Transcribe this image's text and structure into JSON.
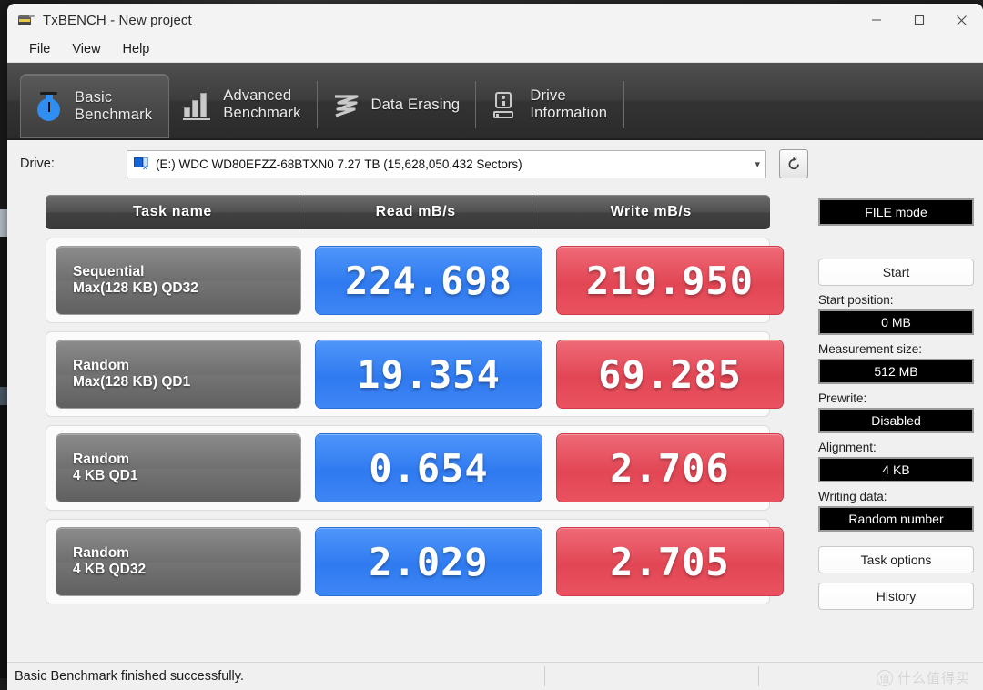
{
  "window": {
    "title": "TxBENCH - New project",
    "app_icon": "hard-disk-icon",
    "controls": {
      "minimize": "minimize-icon",
      "maximize": "maximize-icon",
      "close": "close-icon"
    }
  },
  "menu": {
    "items": [
      "File",
      "View",
      "Help"
    ]
  },
  "tabs": [
    {
      "label": "Basic\nBenchmark",
      "icon": "stopwatch-icon",
      "active": true
    },
    {
      "label": "Advanced\nBenchmark",
      "icon": "bar-chart-icon",
      "active": false
    },
    {
      "label": "Data Erasing",
      "icon": "erase-icon",
      "active": false
    },
    {
      "label": "Drive\nInformation",
      "icon": "drive-info-icon",
      "active": false
    }
  ],
  "drive": {
    "label": "Drive:",
    "value": "(E:) WDC WD80EFZZ-68BTXN0  7.27 TB (15,628,050,432 Sectors)",
    "icon": "disk-volume-icon",
    "caret": "chevron-down-icon",
    "refresh_icon": "refresh-icon"
  },
  "results": {
    "headers": [
      "Task name",
      "Read mB/s",
      "Write mB/s"
    ],
    "rows": [
      {
        "name_line1": "Sequential",
        "name_line2": "Max(128 KB) QD32",
        "read": "224.698",
        "write": "219.950"
      },
      {
        "name_line1": "Random",
        "name_line2": "Max(128 KB) QD1",
        "read": "19.354",
        "write": "69.285"
      },
      {
        "name_line1": "Random",
        "name_line2": "4 KB QD1",
        "read": "0.654",
        "write": "2.706"
      },
      {
        "name_line1": "Random",
        "name_line2": "4 KB QD32",
        "read": "2.029",
        "write": "2.705"
      }
    ],
    "colors": {
      "read": "#3f86f5",
      "write": "#ea5260",
      "task": "#6f6f6f",
      "header": "#4f4f4f"
    }
  },
  "panel": {
    "mode_button": "FILE mode",
    "start_button": "Start",
    "fields": [
      {
        "label": "Start position:",
        "value": "0 MB"
      },
      {
        "label": "Measurement size:",
        "value": "512 MB"
      },
      {
        "label": "Prewrite:",
        "value": "Disabled"
      },
      {
        "label": "Alignment:",
        "value": "4 KB"
      },
      {
        "label": "Writing data:",
        "value": "Random number"
      }
    ],
    "task_options_button": "Task options",
    "history_button": "History"
  },
  "status": {
    "message": "Basic Benchmark finished successfully.",
    "watermark_mark": "值",
    "watermark_text": "什么值得买"
  },
  "chart_data": {
    "type": "bar",
    "title": "TxBENCH Basic Benchmark results",
    "categories": [
      "Sequential Max(128 KB) QD32",
      "Random Max(128 KB) QD1",
      "Random 4 KB QD1",
      "Random 4 KB QD32"
    ],
    "series": [
      {
        "name": "Read mB/s",
        "values": [
          224.698,
          19.354,
          0.654,
          2.029
        ]
      },
      {
        "name": "Write mB/s",
        "values": [
          219.95,
          69.285,
          2.706,
          2.705
        ]
      }
    ],
    "xlabel": "Task name",
    "ylabel": "mB/s",
    "legend_position": "top",
    "grid": false
  }
}
